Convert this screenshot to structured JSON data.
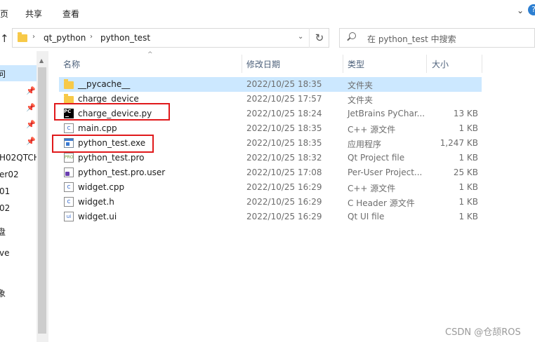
{
  "ribbon": {
    "tabs": [
      "页",
      "共享",
      "查看"
    ]
  },
  "address": {
    "crumbs": [
      "qt_python",
      "python_test"
    ]
  },
  "search": {
    "placeholder": "在 python_test 中搜索"
  },
  "nav": {
    "items": [
      "问",
      "H02QTCH",
      "er02",
      "01",
      "02",
      "盘",
      "ve",
      "象"
    ]
  },
  "columns": {
    "name": "名称",
    "date": "修改日期",
    "type": "类型",
    "size": "大小"
  },
  "files": [
    {
      "name": "__pycache__",
      "date": "2022/10/25 18:35",
      "type": "文件夹",
      "size": "",
      "icon": "folder-icon"
    },
    {
      "name": "charge_device",
      "date": "2022/10/25 17:57",
      "type": "文件夹",
      "size": "",
      "icon": "folder-icon"
    },
    {
      "name": "charge_device.py",
      "date": "2022/10/25 18:24",
      "type": "JetBrains PyChar...",
      "size": "13 KB",
      "icon": "pycharm-icon"
    },
    {
      "name": "main.cpp",
      "date": "2022/10/25 18:35",
      "type": "C++ 源文件",
      "size": "1 KB",
      "icon": "cpp-file-icon"
    },
    {
      "name": "python_test.exe",
      "date": "2022/10/25 18:35",
      "type": "应用程序",
      "size": "1,247 KB",
      "icon": "exe-icon"
    },
    {
      "name": "python_test.pro",
      "date": "2022/10/25 18:32",
      "type": "Qt Project file",
      "size": "1 KB",
      "icon": "qt-project-icon"
    },
    {
      "name": "python_test.pro.user",
      "date": "2022/10/25 17:08",
      "type": "Per-User Project...",
      "size": "25 KB",
      "icon": "user-project-icon"
    },
    {
      "name": "widget.cpp",
      "date": "2022/10/25 16:29",
      "type": "C++ 源文件",
      "size": "1 KB",
      "icon": "cpp-file-icon"
    },
    {
      "name": "widget.h",
      "date": "2022/10/25 16:29",
      "type": "C Header 源文件",
      "size": "1 KB",
      "icon": "header-file-icon"
    },
    {
      "name": "widget.ui",
      "date": "2022/10/25 16:29",
      "type": "Qt UI file",
      "size": "1 KB",
      "icon": "ui-file-icon"
    }
  ],
  "watermark": "CSDN @仓颉ROS",
  "colors": {
    "selection": "#cce8ff",
    "highlight_box": "#e0191b",
    "folder": "#f7c948"
  }
}
